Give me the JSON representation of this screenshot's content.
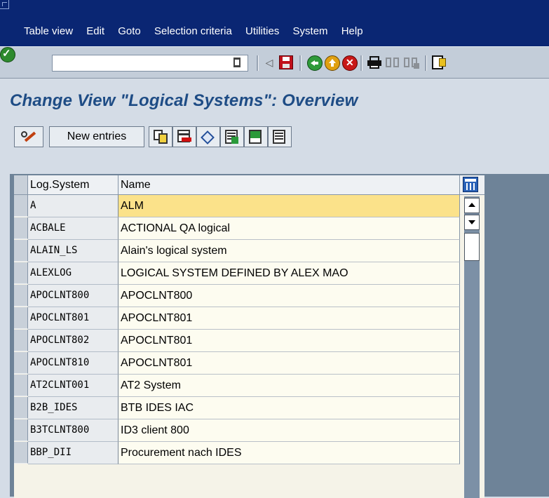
{
  "menu": {
    "items": [
      "Table view",
      "Edit",
      "Goto",
      "Selection criteria",
      "Utilities",
      "System",
      "Help"
    ]
  },
  "toolbar": {
    "command_value": "",
    "icons": [
      "ok-icon",
      "back-icon",
      "exit-icon",
      "cancel-icon",
      "print-icon",
      "find-icon",
      "find-next-icon",
      "first-page-icon"
    ]
  },
  "page": {
    "title": "Change View \"Logical Systems\": Overview"
  },
  "app_toolbar": {
    "new_entries_label": "New entries"
  },
  "table": {
    "headers": [
      "Log.System",
      "Name"
    ],
    "rows": [
      {
        "key": "A",
        "name": "ALM"
      },
      {
        "key": "ACBALE",
        "name": "ACTIONAL QA logical"
      },
      {
        "key": "ALAIN_LS",
        "name": "Alain's logical system"
      },
      {
        "key": "ALEXLOG",
        "name": "LOGICAL SYSTEM DEFINED BY ALEX MAO"
      },
      {
        "key": "APOCLNT800",
        "name": "APOCLNT800"
      },
      {
        "key": "APOCLNT801",
        "name": "APOCLNT801"
      },
      {
        "key": "APOCLNT802",
        "name": "APOCLNT801"
      },
      {
        "key": "APOCLNT810",
        "name": "APOCLNT801"
      },
      {
        "key": "AT2CLNT001",
        "name": "AT2 System"
      },
      {
        "key": "B2B_IDES",
        "name": "BTB IDES IAC"
      },
      {
        "key": "B3TCLNT800",
        "name": "ID3 client  800"
      },
      {
        "key": "BBP_DII",
        "name": "Procurement nach IDES"
      }
    ]
  },
  "colors": {
    "menubar": "#0a2673",
    "title": "#1e4c85",
    "active_cell": "#fbe28a"
  }
}
